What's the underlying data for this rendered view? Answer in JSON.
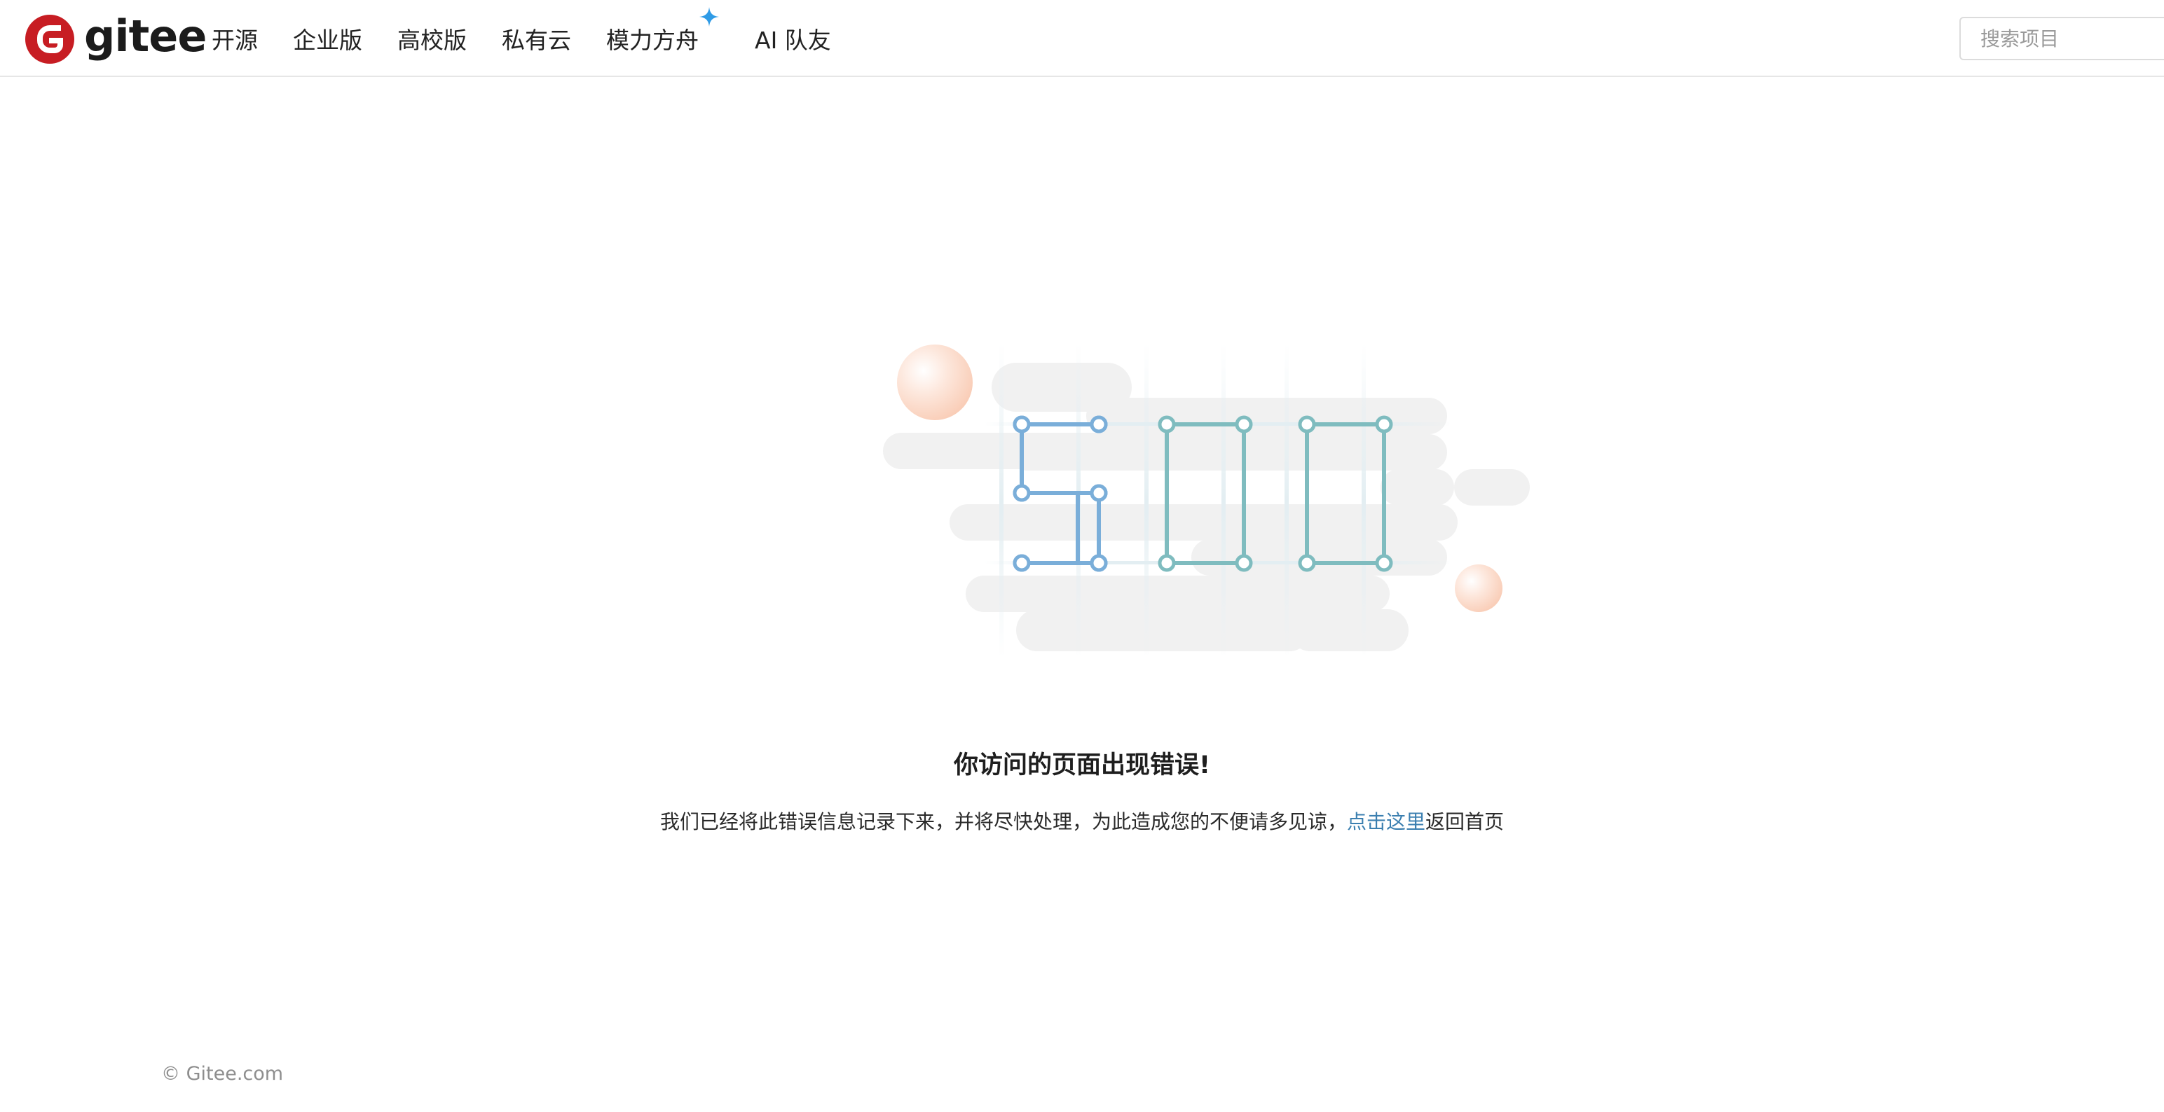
{
  "brand": {
    "name": "gitee",
    "accent_color": "#c71d23"
  },
  "nav": {
    "items": [
      {
        "label": "开源"
      },
      {
        "label": "企业版"
      },
      {
        "label": "高校版"
      },
      {
        "label": "私有云"
      },
      {
        "label": "模力方舟",
        "badge_icon": "sparkle-icon"
      },
      {
        "label": "AI 队友"
      }
    ]
  },
  "search": {
    "placeholder": "搜索项目",
    "value": ""
  },
  "error": {
    "code": "500",
    "title": "你访问的页面出现错误!",
    "description_before": "我们已经将此错误信息记录下来，并将尽快处理，为此造成您的不便请多见谅，",
    "link_label": "点击这里",
    "description_after": "返回首页"
  },
  "colors": {
    "digit_five": "#7aaed9",
    "digit_zero": "#7fbcbf",
    "cloud": "#f0f0f0",
    "link": "#3b7fb0"
  },
  "footer": {
    "copyright": "© Gitee.com"
  }
}
